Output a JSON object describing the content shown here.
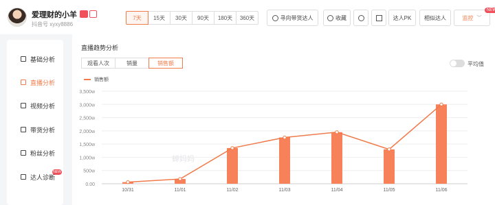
{
  "profile": {
    "name": "爱理财的小羊",
    "account": "抖音号 xyxy8886"
  },
  "date_ranges": {
    "items": [
      "7天",
      "15天",
      "30天",
      "90天",
      "180天",
      "360天"
    ],
    "active_index": 0
  },
  "actions": {
    "find_promoter": "寻向带货达人",
    "favorite": "收藏",
    "pk": "达人PK",
    "similar": "相似达人",
    "monitor": "监控",
    "new_tag": "NEW"
  },
  "sidebar": {
    "items": [
      {
        "label": "基础分析",
        "icon": "chart-icon"
      },
      {
        "label": "直播分析",
        "icon": "live-icon"
      },
      {
        "label": "视频分析",
        "icon": "play-icon"
      },
      {
        "label": "带货分析",
        "icon": "bag-icon"
      },
      {
        "label": "粉丝分析",
        "icon": "fans-icon"
      },
      {
        "label": "达人诊断",
        "icon": "diagnose-icon"
      }
    ],
    "active_index": 1,
    "hot_tag": "NEW"
  },
  "panel": {
    "title": "直播趋势分析",
    "tabs": [
      "观看人次",
      "销量",
      "销售额"
    ],
    "active_tab": 2,
    "toggle_label": "平均值",
    "watermark": "蝉妈妈"
  },
  "colors": {
    "accent": "#f07a4a",
    "bar": "#f7825a",
    "line": "#f07a4a"
  },
  "chart_data": {
    "type": "bar",
    "categories": [
      "10/31",
      "11/01",
      "11/02",
      "11/03",
      "11/04",
      "11/05",
      "11/06"
    ],
    "series": [
      {
        "name": "销售额",
        "values": [
          60,
          180,
          1350,
          1750,
          1950,
          1300,
          3000
        ]
      }
    ],
    "ylim": [
      0,
      3500
    ],
    "yticks": [
      "0.00",
      "500w",
      "1,000w",
      "1,500w",
      "2,000w",
      "2,500w",
      "3,000w",
      "3,500w"
    ],
    "legend": "top-left",
    "grid": true
  }
}
